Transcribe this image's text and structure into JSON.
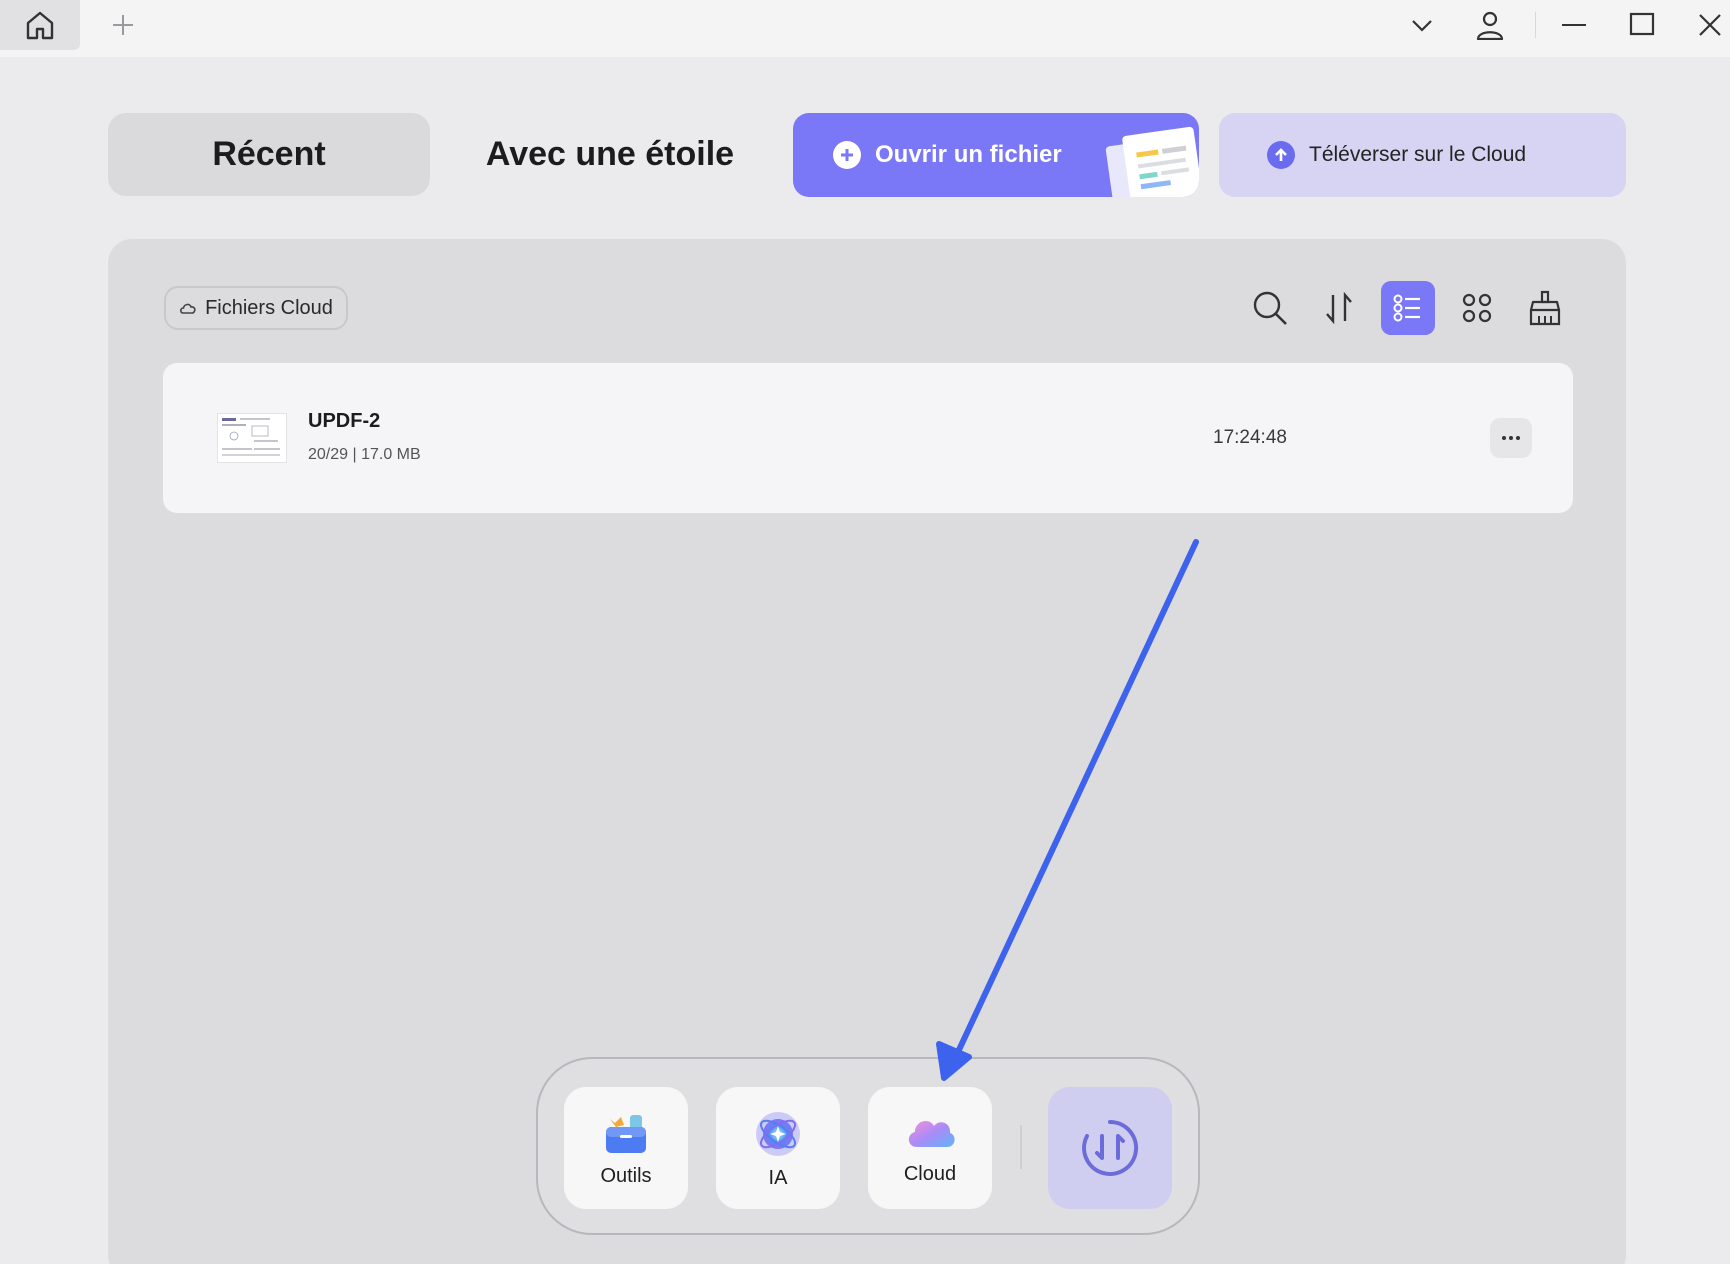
{
  "window": {
    "icons": {
      "home": "home-icon",
      "new_tab": "plus-icon",
      "dropdown": "chevron-down-icon",
      "account": "user-icon",
      "minimize": "minimize-icon",
      "maximize": "maximize-icon",
      "close": "close-icon"
    }
  },
  "tabs": {
    "recent": "Récent",
    "starred": "Avec une étoile"
  },
  "actions": {
    "open_file": "Ouvrir un fichier",
    "upload_cloud": "Téléverser sur le Cloud"
  },
  "panel": {
    "filter_chip": "Fichiers Cloud",
    "toolbar": {
      "search": "search-icon",
      "sort": "sort-icon",
      "list_view": "list-view-icon",
      "grid_view": "grid-view-icon",
      "clean": "broom-icon"
    },
    "files": [
      {
        "name": "UPDF-2",
        "meta": "20/29 | 17.0 MB",
        "time": "17:24:48"
      }
    ]
  },
  "dock": {
    "items": [
      {
        "label": "Outils",
        "icon": "toolbox-icon"
      },
      {
        "label": "IA",
        "icon": "ai-icon"
      },
      {
        "label": "Cloud",
        "icon": "cloud-icon"
      }
    ],
    "sync_icon": "sync-icon"
  },
  "colors": {
    "accent": "#7a78f6",
    "upload_bg": "#d6d4f2",
    "arrow": "#3d63ee"
  }
}
